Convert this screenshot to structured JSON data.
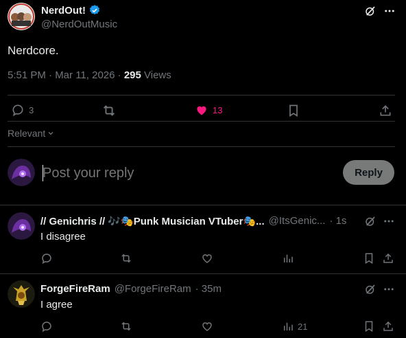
{
  "post": {
    "author_name": "NerdOut!",
    "author_handle": "@NerdOutMusic",
    "text": "Nerdcore.",
    "time": "5:51 PM · Mar 11, 2026 · ",
    "views_count": "295",
    "views_label": " Views",
    "replies": "3",
    "likes": "13",
    "colors": {
      "like": "#f91880",
      "verified": "#1d9bf0"
    }
  },
  "sort": {
    "label": "Relevant"
  },
  "composer": {
    "placeholder": "Post your reply",
    "button": "Reply"
  },
  "comments": [
    {
      "name": "// Genichris // 🎶🎭Punk Musician VTuber🎭...",
      "handle": "@ItsGenic...",
      "time": "· 1s",
      "text": "I disagree",
      "views": ""
    },
    {
      "name": "ForgeFireRam",
      "handle": "@ForgeFireRam",
      "time": "· 35m",
      "text": "I agree",
      "views": "21"
    }
  ]
}
